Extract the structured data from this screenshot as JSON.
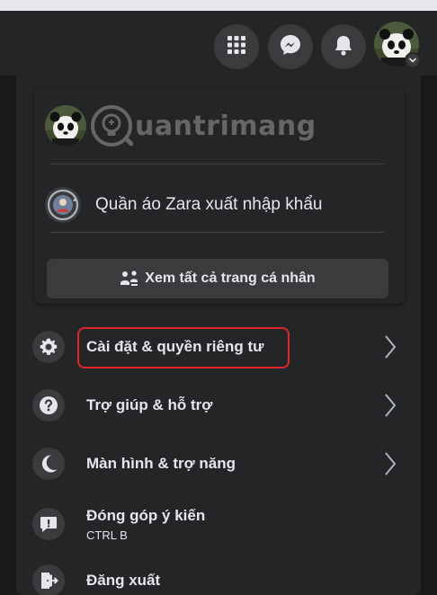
{
  "topbar": {
    "icons": [
      "apps-grid-icon",
      "messenger-icon",
      "notifications-bell-icon"
    ],
    "avatar": "profile-avatar"
  },
  "account": {
    "brand_name": "uantrimang",
    "page_name": "Quần áo Zara xuất nhập khẩu",
    "see_all_label": "Xem tất cả trang cá nhân"
  },
  "menu": {
    "items": [
      {
        "label": "Cài đặt & quyền riêng tư",
        "icon": "gear-icon",
        "has_chevron": true,
        "highlighted": true
      },
      {
        "label": "Trợ giúp & hỗ trợ",
        "icon": "help-icon",
        "has_chevron": true
      },
      {
        "label": "Màn hình & trợ năng",
        "icon": "moon-icon",
        "has_chevron": true
      },
      {
        "label": "Đóng góp ý kiến",
        "sub": "CTRL B",
        "icon": "feedback-icon",
        "has_chevron": false
      },
      {
        "label": "Đăng xuất",
        "icon": "logout-icon",
        "has_chevron": false
      }
    ]
  },
  "colors": {
    "background": "#18191a",
    "panel": "#242526",
    "button": "#3a3b3c",
    "text": "#e4e6eb",
    "highlight": "#e0262b"
  }
}
